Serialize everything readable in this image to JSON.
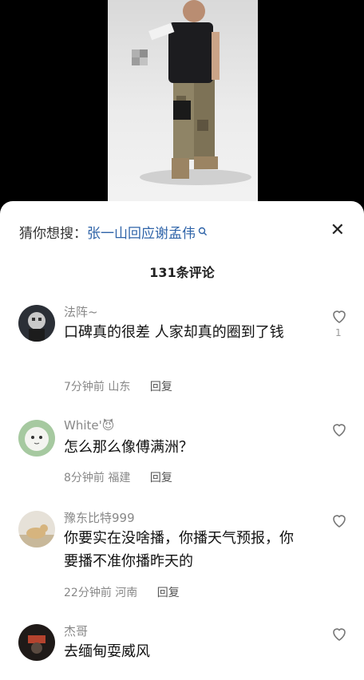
{
  "search_suggestion": {
    "label": "猜你想搜：",
    "query": "张一山回应谢孟伟"
  },
  "header": {
    "comment_count": "131条评论",
    "close_glyph": "✕"
  },
  "comments": [
    {
      "username": "法阵~",
      "text": "口碑真的很差    人家却真的圈到了钱",
      "time": "7分钟前",
      "location": "山东",
      "reply_label": "回复",
      "likes": "1"
    },
    {
      "username": "White'😈",
      "text": "怎么那么像傅满洲？",
      "time": "8分钟前",
      "location": "福建",
      "reply_label": "回复"
    },
    {
      "username": "豫东比特999",
      "text": "你要实在没啥播，你播天气预报，你要播不准你播昨天的",
      "time": "22分钟前",
      "location": "河南",
      "reply_label": "回复"
    },
    {
      "username": "杰哥",
      "text": "去缅甸耍威风"
    }
  ],
  "icons": {
    "close": "close-icon",
    "search": "search-icon",
    "like": "heart-outline-icon"
  },
  "colors": {
    "link": "#2e63a8",
    "meta": "#888888",
    "background": "#ffffff"
  }
}
